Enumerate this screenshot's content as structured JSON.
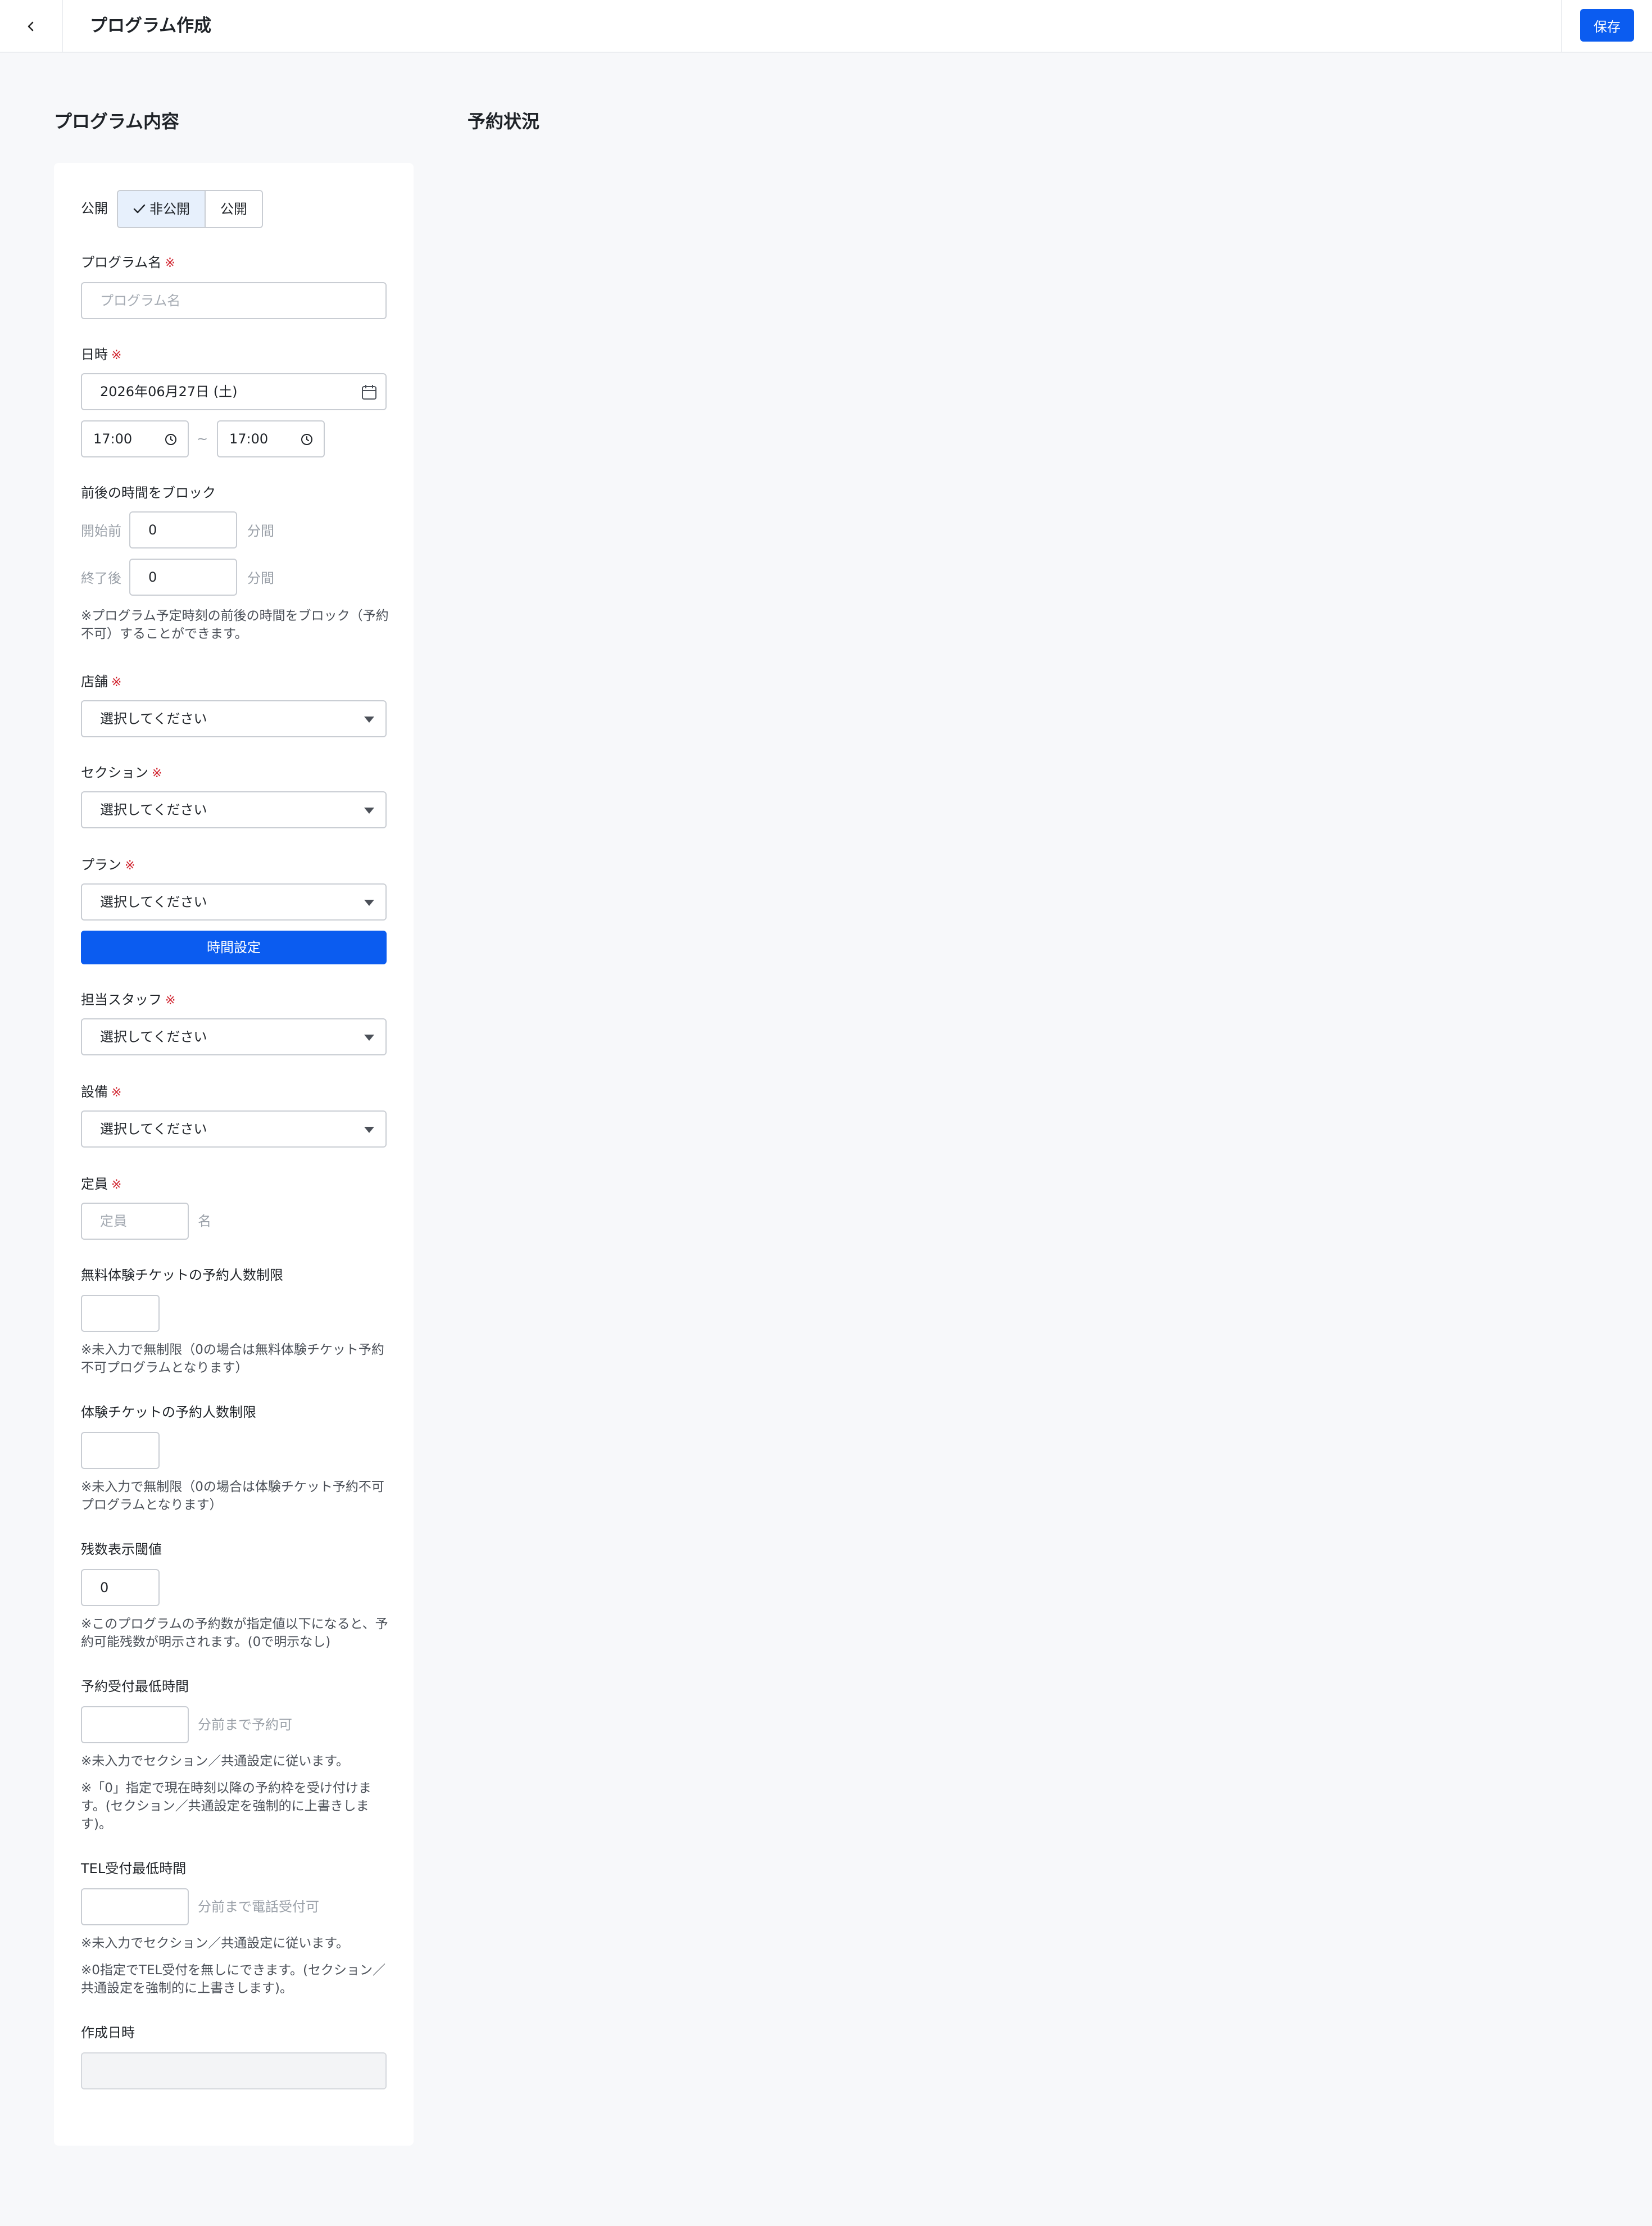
{
  "header": {
    "back_icon": "chevron-left-icon",
    "title": "プログラム作成",
    "save_label": "保存"
  },
  "sections": {
    "content_title": "プログラム内容",
    "status_title": "予約状況"
  },
  "form": {
    "required_mark": "※",
    "publish": {
      "label": "公開",
      "options": [
        "非公開",
        "公開"
      ],
      "selected": "非公開"
    },
    "program_name": {
      "label": "プログラム名",
      "placeholder": "プログラム名",
      "value": ""
    },
    "datetime": {
      "label": "日時",
      "date": "2026年06月27日 (土)",
      "start_time": "17:00",
      "end_time": "17:00",
      "separator": "~"
    },
    "block": {
      "label": "前後の時間をブロック",
      "before_label": "開始前",
      "before_value": "0",
      "after_label": "終了後",
      "after_value": "0",
      "unit": "分間",
      "note": "※プログラム予定時刻の前後の時間をブロック（予約不可）することができます。"
    },
    "store": {
      "label": "店舗",
      "value": "選択してください"
    },
    "section": {
      "label": "セクション",
      "value": "選択してください"
    },
    "plan": {
      "label": "プラン",
      "value": "選択してください",
      "time_button": "時間設定"
    },
    "staff": {
      "label": "担当スタッフ",
      "value": "選択してください"
    },
    "equipment": {
      "label": "設備",
      "value": "選択してください"
    },
    "capacity": {
      "label": "定員",
      "placeholder": "定員",
      "unit": "名"
    },
    "free_trial_limit": {
      "label": "無料体験チケットの予約人数制限",
      "note": "※未入力で無制限（0の場合は無料体験チケット予約不可プログラムとなります）"
    },
    "trial_limit": {
      "label": "体験チケットの予約人数制限",
      "note": "※未入力で無制限（0の場合は体験チケット予約不可プログラムとなります）"
    },
    "remaining_threshold": {
      "label": "残数表示閾値",
      "value": "0",
      "note": "※このプログラムの予約数が指定値以下になると、予約可能残数が明示されます。(0で明示なし)"
    },
    "min_booking_time": {
      "label": "予約受付最低時間",
      "suffix": "分前まで予約可",
      "note1": "※未入力でセクション／共通設定に従います。",
      "note2": "※「0」指定で現在時刻以降の予約枠を受け付けます。(セクション／共通設定を強制的に上書きします)。"
    },
    "tel_min_time": {
      "label": "TEL受付最低時間",
      "suffix": "分前まで電話受付可",
      "note1": "※未入力でセクション／共通設定に従います。",
      "note2": "※0指定でTEL受付を無しにできます。(セクション／共通設定を強制的に上書きします)。"
    },
    "created_at": {
      "label": "作成日時",
      "value": ""
    }
  }
}
